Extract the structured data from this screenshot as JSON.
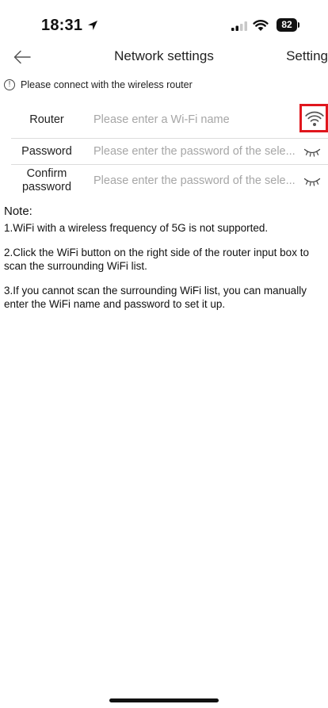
{
  "status_bar": {
    "time": "18:31",
    "battery": "82"
  },
  "nav": {
    "title": "Network settings",
    "action_label": "Setting"
  },
  "notice": {
    "icon_glyph": "!",
    "text": "Please connect with the wireless router"
  },
  "form": {
    "router": {
      "label": "Router",
      "placeholder": "Please enter a Wi-Fi name",
      "value": ""
    },
    "password": {
      "label": "Password",
      "placeholder": "Please enter the password of the sele...",
      "value": ""
    },
    "confirm_password": {
      "label": "Confirm password",
      "placeholder": "Please enter the password of the sele...",
      "value": ""
    }
  },
  "notes": {
    "title": "Note:",
    "items": [
      "1.WiFi with a wireless frequency of 5G is not supported.",
      "2.Click the WiFi button on the right side of the router input box to scan the surrounding WiFi list.",
      "3.If you cannot scan the surrounding WiFi list, you can manually enter the WiFi name and password to set it up."
    ]
  },
  "colors": {
    "highlight_border": "#e0161d",
    "placeholder": "#a6a6a6",
    "divider": "#dcdcdc"
  },
  "icons": {
    "back": "arrow-left-icon",
    "wifi_scan": "wifi-icon",
    "password_toggle": "closed-eye-icon",
    "notice": "exclamation-circle-icon"
  }
}
